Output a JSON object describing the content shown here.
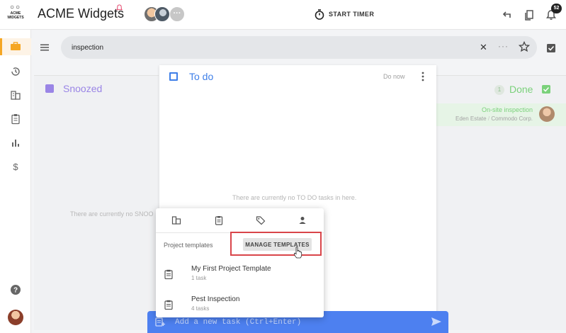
{
  "brand": {
    "logo_text": "ACME WIDGETS",
    "app_title": "ACME Widgets",
    "color_primary": "#4d80f0",
    "color_accent": "#f5a623"
  },
  "header": {
    "avatars_more": "···",
    "timer_label": "START TIMER",
    "notifications_count": "52",
    "icons": [
      "timer-icon",
      "undo-icon",
      "copy-icon",
      "bell-icon"
    ]
  },
  "sidebar": {
    "items": [
      {
        "icon": "briefcase-icon",
        "active": true
      },
      {
        "icon": "history-icon"
      },
      {
        "icon": "building-icon"
      },
      {
        "icon": "clipboard-icon"
      },
      {
        "icon": "bar-chart-icon"
      },
      {
        "icon": "dollar-icon"
      },
      {
        "icon": "help-icon"
      }
    ]
  },
  "search": {
    "value": "inspection",
    "more": "···"
  },
  "columns": {
    "snoozed": {
      "title": "Snoozed",
      "empty": "There are currently no SNOO",
      "color": "#9a85e6"
    },
    "todo": {
      "title": "To do",
      "action": "Do now",
      "empty": "There are currently no TO DO tasks in here.",
      "color": "#3f7fe8"
    },
    "done": {
      "title": "Done",
      "count": "1",
      "color": "#7bd17b",
      "tasks": [
        {
          "title": "On-site inspection",
          "project": "Eden Estate",
          "separator": "/",
          "client": "Commodo Corp."
        }
      ]
    }
  },
  "popup": {
    "tabs": [
      "building-icon",
      "clipboard-icon",
      "tag-icon",
      "person-icon"
    ],
    "section_label": "Project templates",
    "manage_button": "MANAGE TEMPLATES",
    "templates": [
      {
        "name": "My First Project Template",
        "count": "1 task"
      },
      {
        "name": "Pest Inspection",
        "count": "4 tasks"
      }
    ]
  },
  "add_task": {
    "placeholder": "Add a new task (Ctrl+Enter)"
  }
}
